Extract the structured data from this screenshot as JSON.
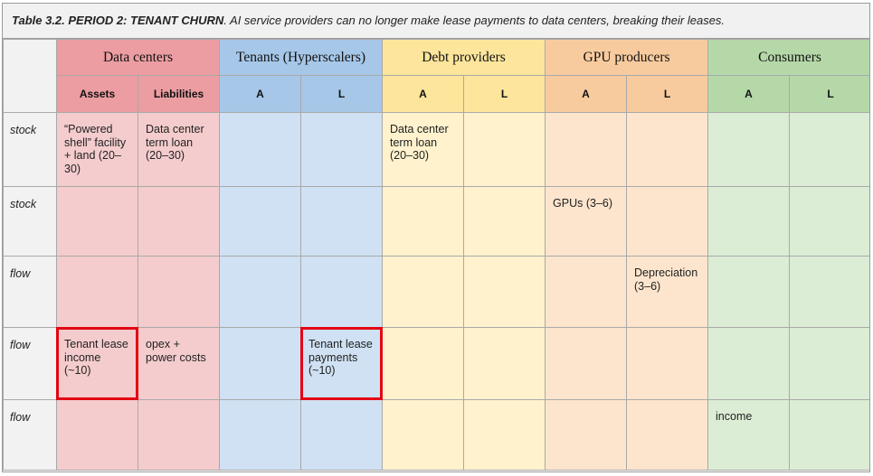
{
  "caption": {
    "title": "Table 3.2. PERIOD 2: TENANT CHURN",
    "subtitle": ". AI service providers can no longer make lease payments to data centers, breaking their leases."
  },
  "groups": {
    "data_centers": "Data centers",
    "tenants": "Tenants (Hyperscalers)",
    "debt": "Debt providers",
    "gpu": "GPU producers",
    "consumers": "Consumers"
  },
  "subheaders": {
    "dc_assets": "Assets",
    "dc_liabilities": "Liabilities",
    "a": "A",
    "l": "L"
  },
  "rows": [
    {
      "label": "stock",
      "dc_assets": "“Powered shell” facility + land (20–30)",
      "dc_liabilities": "Data center term loan (20–30)",
      "debt_a": "Data center term loan (20–30)"
    },
    {
      "label": "stock",
      "gpu_a": "GPUs (3–6)"
    },
    {
      "label": "flow",
      "gpu_l": "Depreciation (3–6)"
    },
    {
      "label": "flow",
      "dc_assets": "Tenant lease income (~10)",
      "dc_liabilities": "opex + power costs",
      "tenants_l": "Tenant lease payments (~10)"
    },
    {
      "label": "flow",
      "consumers_a": "income"
    }
  ],
  "highlight_color": "#e30613"
}
